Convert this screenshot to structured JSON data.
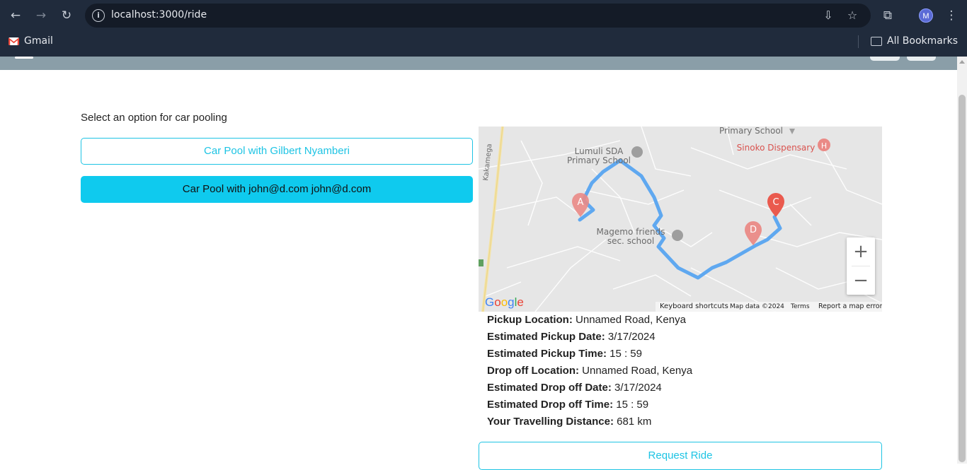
{
  "browser": {
    "url": "localhost:3000/ride",
    "profile_initial": "M",
    "bookmarks": {
      "gmail": "Gmail",
      "all_bookmarks": "All Bookmarks"
    }
  },
  "page": {
    "prompt": "Select an option for car pooling",
    "pool_options": [
      "Car Pool with Gilbert Nyamberi",
      "Car Pool with john@d.com john@d.com"
    ],
    "selected_option_index": 1,
    "request_button": "Request Ride"
  },
  "map": {
    "labels": {
      "primary_school_top": "Primary School",
      "lumuli": "Lumuli SDA\nPrimary School",
      "sinoko": "Sinoko Dispensary",
      "magemo": "Magemo friends\nsec. school",
      "road": "Kakamega"
    },
    "markers": [
      "A",
      "C",
      "D"
    ],
    "google": "Google",
    "attribution": {
      "shortcuts": "Keyboard shortcuts",
      "map_data": "Map data ©2024",
      "terms": "Terms",
      "report": "Report a map error"
    }
  },
  "details": [
    {
      "label": "Pickup Location:",
      "value": "Unnamed Road, Kenya"
    },
    {
      "label": "Estimated Pickup Date:",
      "value": "3/17/2024"
    },
    {
      "label": "Estimated Pickup Time:",
      "value": "15 : 59"
    },
    {
      "label": "Drop off Location:",
      "value": "Unnamed Road, Kenya"
    },
    {
      "label": "Estimated Drop off Date:",
      "value": "3/17/2024"
    },
    {
      "label": "Estimated Drop off Time:",
      "value": "15 : 59"
    },
    {
      "label": "Your Travelling Distance:",
      "value": "681 km"
    }
  ],
  "colors": {
    "accent": "#0fcaee",
    "header": "#8a9ea8",
    "route": "#5fa8f0",
    "marker": "#ea5a4e"
  }
}
